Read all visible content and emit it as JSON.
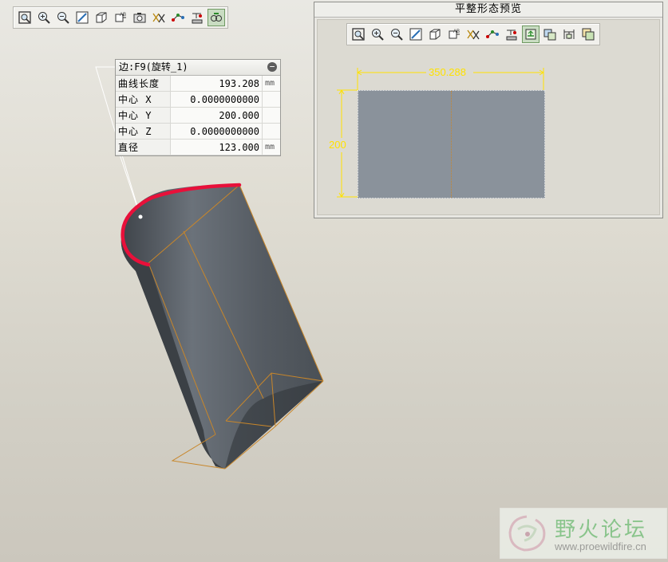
{
  "toolbar": {
    "buttons": [
      {
        "icon": "zoom-fit-icon"
      },
      {
        "icon": "zoom-in-icon"
      },
      {
        "icon": "zoom-out-icon"
      },
      {
        "icon": "repaint-icon"
      },
      {
        "icon": "view-orient-icon"
      },
      {
        "icon": "saved-views-icon"
      },
      {
        "icon": "camera-icon"
      },
      {
        "icon": "datum-planes-icon"
      },
      {
        "icon": "datum-axes-icon"
      },
      {
        "icon": "datum-points-icon"
      },
      {
        "icon": "spin-center-icon",
        "active": true
      }
    ]
  },
  "info_panel": {
    "title": "边:F9(旋转_1)",
    "collapse_glyph": "−",
    "rows": [
      {
        "label": "曲线长度",
        "value": "193.208",
        "unit": "mm"
      },
      {
        "label": "中心 X",
        "value": "0.0000000000",
        "unit": ""
      },
      {
        "label": "中心 Y",
        "value": "200.000",
        "unit": ""
      },
      {
        "label": "中心 Z",
        "value": "0.0000000000",
        "unit": ""
      },
      {
        "label": "直径",
        "value": "123.000",
        "unit": "mm"
      }
    ]
  },
  "preview": {
    "title": "平整形态预览",
    "width_dim": "350.288",
    "height_dim": "200",
    "toolbar_icons": [
      "zoom-fit-icon",
      "zoom-in-icon",
      "zoom-out-icon",
      "repaint-icon",
      "view-orient-icon",
      "saved-views-icon",
      "datum-planes-icon",
      "datum-axes-icon",
      "datum-points-icon",
      "fill-icon",
      "display-icon",
      "dimension-icon",
      "copy-icon"
    ],
    "active_toolbar_icon": "fill-icon"
  },
  "watermark": {
    "title": "野火论坛",
    "url": "www.proewildfire.cn"
  },
  "colors": {
    "surface": "#5b626b",
    "highlight_edge": "#e8103a",
    "dimension": "#ffe200",
    "wireframe": "#c8862a"
  }
}
